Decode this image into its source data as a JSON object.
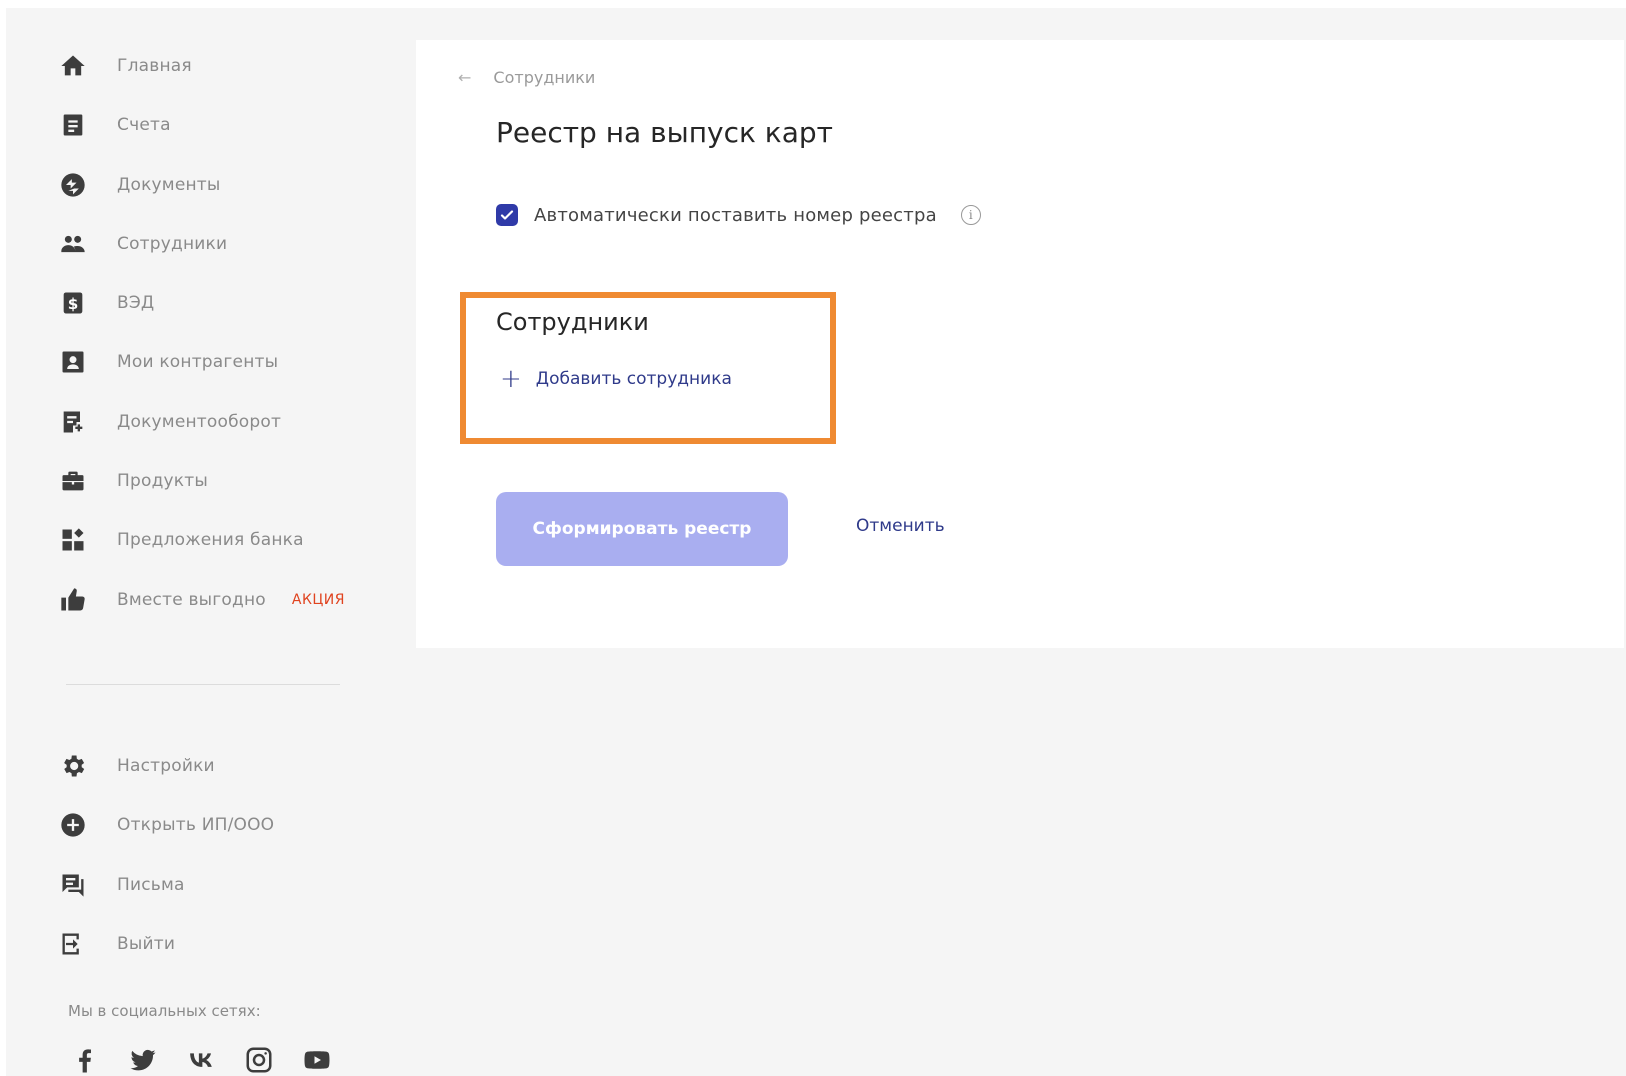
{
  "sidebar": {
    "items": [
      {
        "label": "Главная",
        "icon": "home-icon"
      },
      {
        "label": "Счета",
        "icon": "document-icon"
      },
      {
        "label": "Документы",
        "icon": "exchange-icon"
      },
      {
        "label": "Сотрудники",
        "icon": "people-icon"
      },
      {
        "label": "ВЭД",
        "icon": "dollar-icon"
      },
      {
        "label": "Мои контрагенты",
        "icon": "contact-card-icon"
      },
      {
        "label": "Документооборот",
        "icon": "document-flow-icon"
      },
      {
        "label": "Продукты",
        "icon": "briefcase-icon"
      },
      {
        "label": "Предложения банка",
        "icon": "widgets-icon"
      },
      {
        "label": "Вместе выгодно",
        "icon": "thumbs-up-icon",
        "badge": "АКЦИЯ"
      }
    ],
    "bottom_items": [
      {
        "label": "Настройки",
        "icon": "gear-icon"
      },
      {
        "label": "Открыть ИП/ООО",
        "icon": "plus-circle-icon"
      },
      {
        "label": "Письма",
        "icon": "messages-icon"
      },
      {
        "label": "Выйти",
        "icon": "logout-icon"
      }
    ],
    "social_title": "Мы в социальных сетях:",
    "social": [
      "facebook-icon",
      "twitter-icon",
      "vk-icon",
      "instagram-icon",
      "youtube-icon"
    ]
  },
  "main": {
    "breadcrumb": "Сотрудники",
    "title": "Реестр на выпуск карт",
    "checkbox_label": "Автоматически поставить номер реестра",
    "checkbox_checked": true,
    "section_title": "Сотрудники",
    "add_label": "Добавить сотрудника",
    "submit_label": "Сформировать реестр",
    "cancel_label": "Отменить"
  },
  "colors": {
    "accent": "#2f3aa8",
    "highlight": "#ef8a32",
    "submit_disabled": "#a9aef0",
    "promo": "#e0431f"
  }
}
